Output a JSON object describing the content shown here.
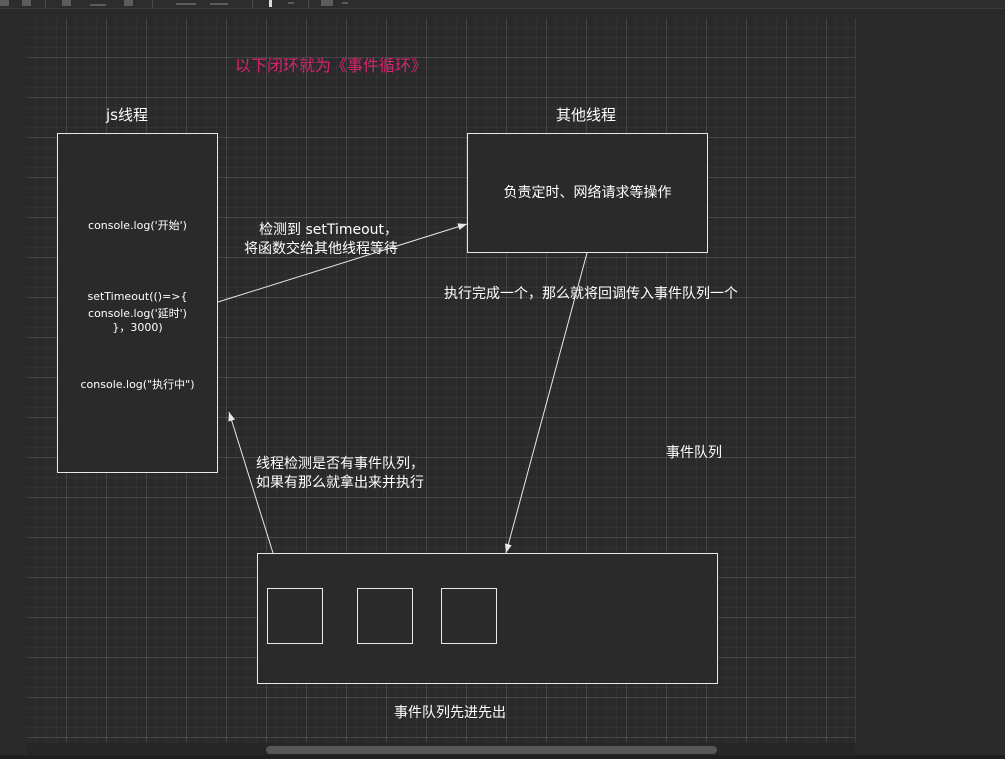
{
  "diagram": {
    "title": "以下闭环就为《事件循环》",
    "js_thread": {
      "heading": "js线程",
      "lines": [
        "console.log('开始')",
        "setTimeout(()=>{",
        "console.log('延时')",
        "}，3000)",
        "console.log(\"执行中\")"
      ]
    },
    "other_thread": {
      "heading": "其他线程",
      "text": "负责定时、网络请求等操作"
    },
    "arrow_notes": {
      "to_other_line1": "检测到 setTimeout，",
      "to_other_line2": "将函数交给其他线程等待",
      "to_queue": "执行完成一个，那么就将回调传入事件队列一个",
      "to_js_line1": "线程检测是否有事件队列，",
      "to_js_line2": "如果有那么就拿出来并执行"
    },
    "queue": {
      "label": "事件队列",
      "caption": "事件队列先进先出"
    }
  },
  "colors": {
    "title": "#d6246e",
    "background": "#2a2a2a",
    "stroke": "#e8e8e8"
  }
}
